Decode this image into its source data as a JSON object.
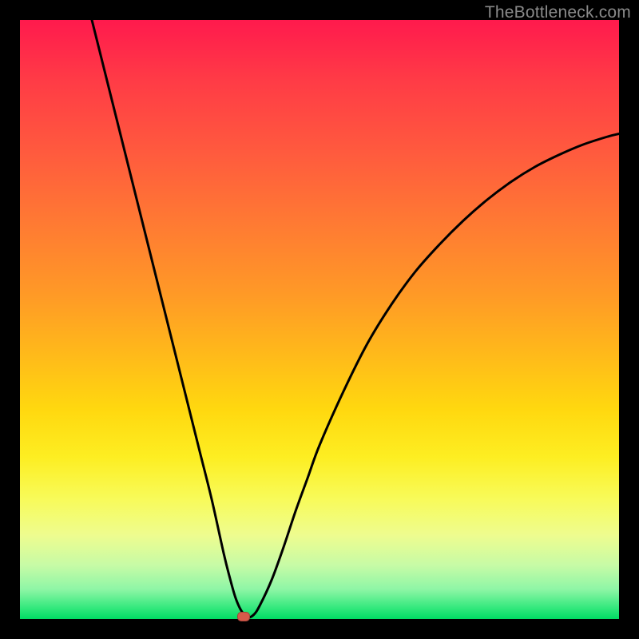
{
  "watermark": "TheBottleneck.com",
  "chart_data": {
    "type": "line",
    "title": "",
    "xlabel": "",
    "ylabel": "",
    "xlim": [
      0,
      100
    ],
    "ylim": [
      0,
      100
    ],
    "series": [
      {
        "name": "curve",
        "x": [
          12,
          14,
          16,
          18,
          20,
          22,
          24,
          26,
          28,
          30,
          32,
          34,
          35,
          36,
          37,
          38,
          39,
          40,
          42,
          44,
          46,
          48,
          50,
          54,
          58,
          62,
          66,
          70,
          74,
          78,
          82,
          86,
          90,
          94,
          98,
          100
        ],
        "values": [
          100,
          92,
          84,
          76,
          68,
          60,
          52,
          44,
          36,
          28,
          20,
          11,
          7,
          3.5,
          1.3,
          0.3,
          0.7,
          2.2,
          6.5,
          12,
          18,
          23.5,
          29,
          38,
          46,
          52.5,
          58,
          62.5,
          66.5,
          70,
          73,
          75.5,
          77.5,
          79.2,
          80.5,
          81
        ]
      }
    ],
    "marker": {
      "x": 37.3,
      "y": 0.4
    },
    "background_gradient": {
      "direction": "vertical",
      "stops": [
        {
          "pos": 0,
          "color": "#ff1a4d"
        },
        {
          "pos": 50,
          "color": "#ffba1a"
        },
        {
          "pos": 80,
          "color": "#f8fb5a"
        },
        {
          "pos": 100,
          "color": "#00dc64"
        }
      ]
    }
  }
}
